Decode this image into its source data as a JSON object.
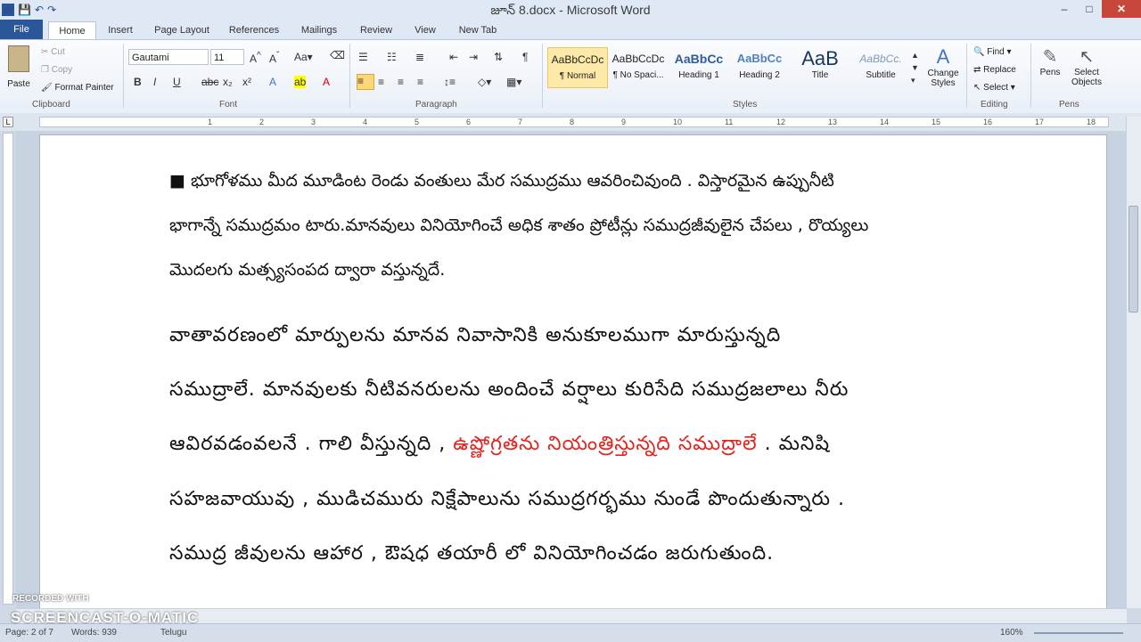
{
  "window": {
    "title": "జూన్ 8.docx - Microsoft Word",
    "minimize": "–",
    "maximize": "□",
    "close": "✕"
  },
  "qat": {
    "save": "💾",
    "undo": "↶",
    "redo": "↷"
  },
  "tabs": {
    "file": "File",
    "home": "Home",
    "insert": "Insert",
    "page_layout": "Page Layout",
    "references": "References",
    "mailings": "Mailings",
    "review": "Review",
    "view": "View",
    "new_tab": "New Tab"
  },
  "clipboard": {
    "paste": "Paste",
    "cut": "Cut",
    "copy": "Copy",
    "format_painter": "Format Painter",
    "label": "Clipboard"
  },
  "font": {
    "name": "Gautami",
    "size": "11",
    "label": "Font"
  },
  "paragraph": {
    "label": "Paragraph"
  },
  "styles": {
    "label": "Styles",
    "items": [
      {
        "preview": "AaBbCcDc",
        "name": "¶ Normal"
      },
      {
        "preview": "AaBbCcDc",
        "name": "¶ No Spaci..."
      },
      {
        "preview": "AaBbCc",
        "name": "Heading 1"
      },
      {
        "preview": "AaBbCc",
        "name": "Heading 2"
      },
      {
        "preview": "AaB",
        "name": "Title"
      },
      {
        "preview": "AaBbCc.",
        "name": "Subtitle"
      }
    ],
    "change_styles": "Change Styles"
  },
  "editing": {
    "find": "Find",
    "replace": "Replace",
    "select": "Select",
    "label": "Editing"
  },
  "pens": {
    "pens": "Pens",
    "select_objects": "Select Objects",
    "label": "Pens"
  },
  "ruler": [
    "1",
    "2",
    "3",
    "4",
    "5",
    "6",
    "7",
    "8",
    "9",
    "10",
    "11",
    "12",
    "13",
    "14",
    "15",
    "16",
    "17",
    "18"
  ],
  "document": {
    "para1": [
      "■ భూగోళము మీద మూడింట రెండు వంతులు మేర సముద్రము ఆవరించివుంది . విస్తారమైన ఉప్పునీటి",
      "భాగాన్నే సముద్రమం టారు.మానవులు వినియోగించే అధిక శాతం ప్రోటీన్లు సముద్రజీవులైన చేపలు , రొయ్యలు",
      "మొదలగు మత్స్యసంపద ద్వారా వస్తున్నదే."
    ],
    "para2": {
      "line1": "వాతావరణంలో మార్పులను మానవ నివాసానికి అనుకూలముగా మారుస్తున్నది",
      "line2": "సముద్రాలే. మానవులకు నీటివనరులను అందించే వర్షాలు కురిసేది సముద్రజలాలు నీరు",
      "line3_a": "ఆవిరవడంవలనే . గాలి వీస్తున్నది , ",
      "line3_red": "ఉష్ణోగ్రతను నియంత్రిస్తున్నది సముద్రాలే",
      "line3_b": " . మనిషి",
      "line4": "సహజవాయువు , ముడిచమురు నిక్షేపాలును సముద్రగర్భము నుండే పొందుతున్నారు .",
      "line5": "సముద్ర జీవులను ఆహార , ఔషధ తయారీ లో వినియోగించడం జరుగుతుంది."
    }
  },
  "status": {
    "page": "Page: 2 of 7",
    "words": "Words: 939",
    "language": "Telugu",
    "zoom": "160%"
  },
  "watermark": {
    "line1": "RECORDED WITH",
    "line2": "SCREENCAST-O-MATIC"
  }
}
